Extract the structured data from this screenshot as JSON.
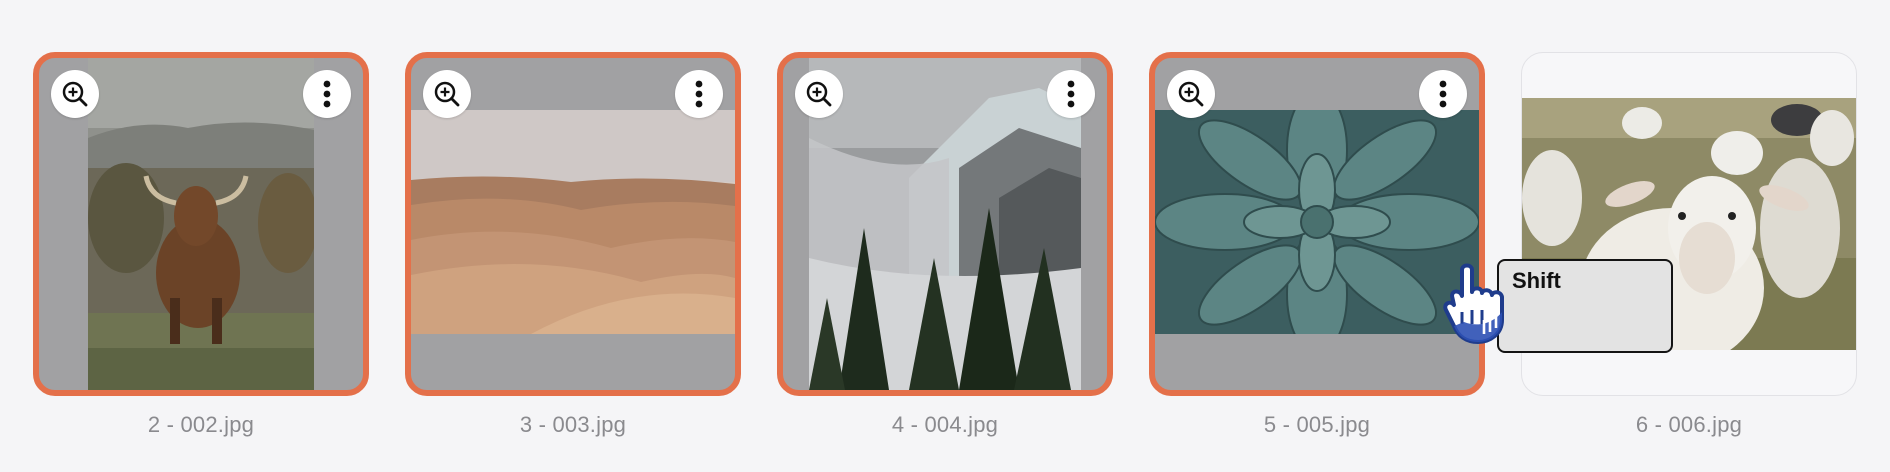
{
  "thumbnails": [
    {
      "caption": "2 - 002.jpg",
      "selected": true,
      "subject": "highland cow in field"
    },
    {
      "caption": "3 - 003.jpg",
      "selected": true,
      "subject": "sand dunes"
    },
    {
      "caption": "4 - 004.jpg",
      "selected": true,
      "subject": "misty mountain with pines"
    },
    {
      "caption": "5 - 005.jpg",
      "selected": true,
      "subject": "succulent rosette"
    },
    {
      "caption": "6 - 006.jpg",
      "selected": false,
      "subject": "sheep flock"
    }
  ],
  "tooltip": {
    "label": "Shift"
  },
  "icons": {
    "zoom": "zoom-in-icon",
    "menu": "more-vertical-icon",
    "cursor": "pointer-hand-icon"
  },
  "colors": {
    "selection_border": "#e4704a",
    "card_fill": "#a1a1a3",
    "background": "#f5f5f7",
    "caption": "#8a8a8e"
  }
}
